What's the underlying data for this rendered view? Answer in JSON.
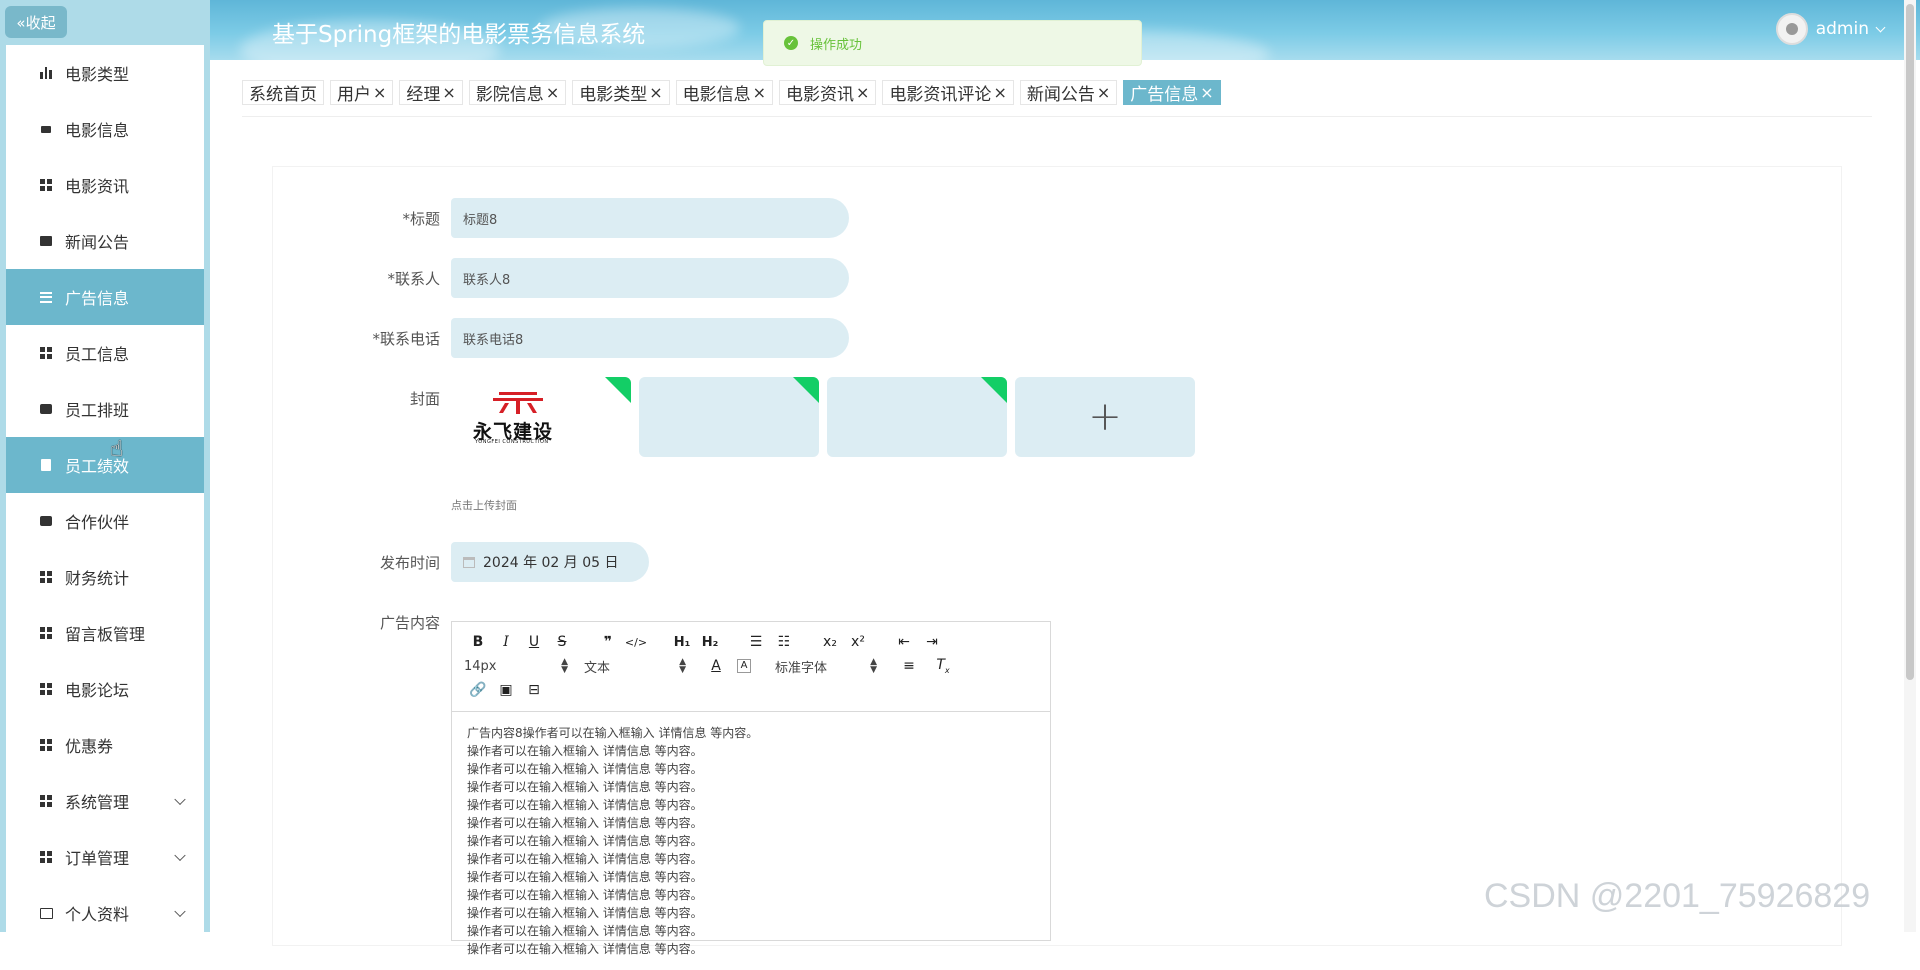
{
  "sidebar": {
    "collapse_label": "«收起",
    "items": [
      {
        "label": "电影类型"
      },
      {
        "label": "电影信息"
      },
      {
        "label": "电影资讯"
      },
      {
        "label": "新闻公告"
      },
      {
        "label": "广告信息"
      },
      {
        "label": "员工信息"
      },
      {
        "label": "员工排班"
      },
      {
        "label": "员工绩效"
      },
      {
        "label": "合作伙伴"
      },
      {
        "label": "财务统计"
      },
      {
        "label": "留言板管理"
      },
      {
        "label": "电影论坛"
      },
      {
        "label": "优惠券"
      },
      {
        "label": "系统管理"
      },
      {
        "label": "订单管理"
      },
      {
        "label": "个人资料"
      }
    ]
  },
  "header": {
    "title": "基于Spring框架的电影票务信息系统",
    "username": "admin"
  },
  "toast": {
    "message": "操作成功"
  },
  "tabs": [
    {
      "label": "系统首页"
    },
    {
      "label": "用户",
      "close": "×"
    },
    {
      "label": "经理",
      "close": "×"
    },
    {
      "label": "影院信息",
      "close": "×"
    },
    {
      "label": "电影类型",
      "close": "×"
    },
    {
      "label": "电影信息",
      "close": "×"
    },
    {
      "label": "电影资讯",
      "close": "×"
    },
    {
      "label": "电影资讯评论",
      "close": "×"
    },
    {
      "label": "新闻公告",
      "close": "×"
    },
    {
      "label": "广告信息",
      "close": "×"
    }
  ],
  "form": {
    "title_label": "标题",
    "title_value": "标题8",
    "contact_label": "联系人",
    "contact_value": "联系人8",
    "phone_label": "联系电话",
    "phone_value": "联系电话8",
    "cover_label": "封面",
    "cover_hint": "点击上传封面",
    "logo_cn": "永飞建设",
    "logo_en": "YONGFEI CONSTRUCTION",
    "date_label": "发布时间",
    "date_value": "2024 年 02 月 05 日",
    "content_label": "广告内容",
    "required_mark": "*"
  },
  "editor": {
    "size_select": "14px",
    "type_select": "文本",
    "font_select": "标准字体",
    "content_lines": [
      "广告内容8操作者可以在输入框输入  详情信息  等内容。",
      "操作者可以在输入框输入  详情信息  等内容。",
      "操作者可以在输入框输入  详情信息  等内容。",
      "操作者可以在输入框输入  详情信息  等内容。",
      "操作者可以在输入框输入  详情信息  等内容。",
      "操作者可以在输入框输入  详情信息  等内容。",
      "操作者可以在输入框输入  详情信息  等内容。",
      "操作者可以在输入框输入  详情信息  等内容。",
      "操作者可以在输入框输入  详情信息  等内容。",
      "操作者可以在输入框输入  详情信息  等内容。",
      "操作者可以在输入框输入  详情信息  等内容。",
      "操作者可以在输入框输入  详情信息  等内容。",
      "操作者可以在输入框输入  详情信息  等内容。"
    ]
  },
  "watermark": "CSDN @2201_75926829",
  "colors": {
    "active": "#6cb7cc",
    "sidebar_bg": "#aedbe8",
    "input_bg": "#dcedf3",
    "success": "#67c23a"
  }
}
